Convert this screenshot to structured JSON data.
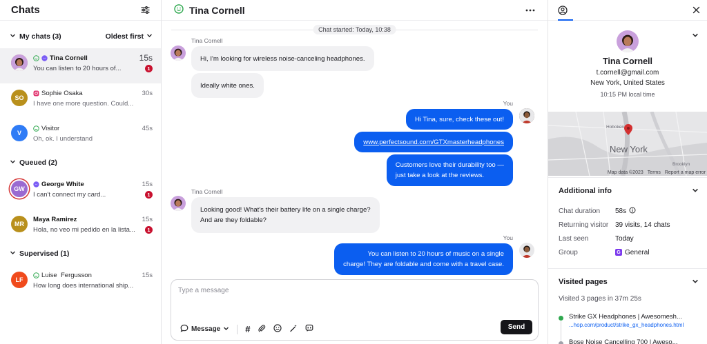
{
  "left": {
    "title": "Chats",
    "my_chats": {
      "label": "My chats (3)",
      "sort": "Oldest first"
    },
    "queued": {
      "label": "Queued (2)"
    },
    "supervised": {
      "label": "Supervised (1)"
    },
    "chats": [
      {
        "name": "Tina Cornell",
        "time": "15s",
        "preview": "You can listen to 20 hours of...",
        "badge": "1"
      },
      {
        "name": "Sophie Osaka",
        "time": "30s",
        "preview": "I have one more question. Could...",
        "initials": "SO",
        "color": "#b9901c"
      },
      {
        "name": "Visitor",
        "time": "45s",
        "preview": "Oh, ok. I understand",
        "initials": "V",
        "color": "#2f7cf6"
      }
    ],
    "queued_chats": [
      {
        "name": "George White",
        "time": "15s",
        "preview": "I can't connect my card...",
        "initials": "GW",
        "color": "#9a6ad1",
        "badge": "1"
      },
      {
        "name": "Maya Ramirez",
        "time": "15s",
        "preview": "Hola, no veo mi pedido en la lista...",
        "initials": "MR",
        "color": "#b9901c",
        "badge": "1"
      }
    ],
    "supervised_chats": [
      {
        "name": "Luise  Fergusson",
        "time": "15s",
        "preview": "How long does international ship...",
        "initials": "LF",
        "color": "#f04a1c"
      }
    ]
  },
  "center": {
    "title": "Tina Cornell",
    "started": "Chat started: Today, 10:38",
    "author_customer": "Tina Cornell",
    "author_agent": "You",
    "messages": {
      "m1": "Hi, I'm looking for wireless noise-canceling headphones.",
      "m2": "Ideally white ones.",
      "m3": "Hi Tina, sure, check these out!",
      "m4": "www.perfectsound.com/GTXmasterheadphones",
      "m5a": "Customers love their durability too —",
      "m5b": "just take a look at the reviews.",
      "m6a": "Looking good! What's their battery life on a single charge?",
      "m6b": "And are they foldable?",
      "m7a": "You can listen to 20 hours of music on a single",
      "m7b": "charge! They are foldable and come with a travel case."
    },
    "composer": {
      "placeholder": "Type a message",
      "mode": "Message",
      "send": "Send"
    }
  },
  "right": {
    "profile": {
      "name": "Tina Cornell",
      "email": "t.cornell@gmail.com",
      "location": "New York, United States",
      "local_time": "10:15 PM local time"
    },
    "map": {
      "city": "New York",
      "labels": [
        "Hoboken",
        "Brooklyn"
      ],
      "data": "Map data ©2023",
      "terms": "Terms",
      "report": "Report a map error"
    },
    "additional": {
      "title": "Additional info",
      "rows": [
        {
          "k": "Chat duration",
          "v": "58s"
        },
        {
          "k": "Returning visitor",
          "v": "39 visits, 14 chats"
        },
        {
          "k": "Last seen",
          "v": "Today"
        },
        {
          "k": "Group",
          "v": "General",
          "icon": "G"
        }
      ]
    },
    "visited": {
      "title": "Visited pages",
      "summary": "Visited 3 pages in 37m 25s",
      "pages": [
        {
          "title": "Strike GX Headphones | Awesomesh...",
          "url": "...hop.com/product/strike_gx_headphones.html"
        },
        {
          "title": "Bose Noise Cancelling 700 | Aweso..."
        }
      ]
    }
  },
  "colors": {
    "accent": "#0b5ef0",
    "badge": "#c8102e",
    "online": "#2fa84f"
  }
}
